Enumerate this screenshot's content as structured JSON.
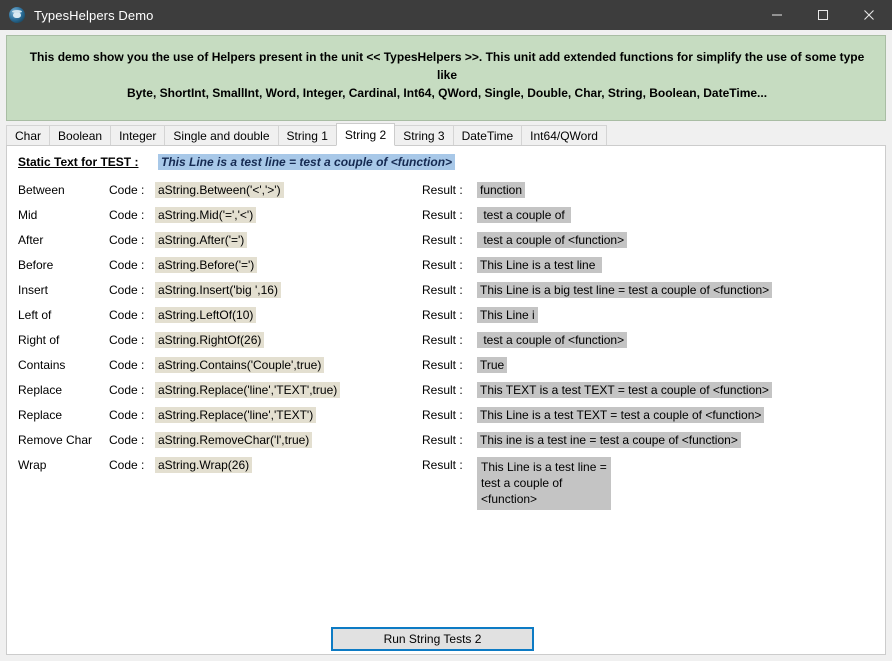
{
  "window": {
    "title": "TypesHelpers Demo",
    "icon": "app-paw-icon",
    "controls": {
      "minimize": "minimize-icon",
      "maximize": "maximize-icon",
      "close": "close-icon"
    },
    "colors": {
      "titlebar": "#3d3d3d",
      "banner_bg": "#c6dcc1",
      "code_bg": "#e3dfd0",
      "result_bg": "#c4c4c4",
      "static_highlight_bg": "#a8c8e8",
      "static_highlight_fg": "#152a52",
      "button_focus_border": "#0d7bc4"
    }
  },
  "banner": {
    "line1": "This demo show you the use of Helpers present in the unit << TypesHelpers >>. This unit add extended functions for simplify the use of some type like",
    "line2": "Byte, ShortInt, SmallInt, Word, Integer, Cardinal, Int64, QWord, Single, Double, Char, String, Boolean, DateTime..."
  },
  "tabs": [
    {
      "label": "Char",
      "active": false
    },
    {
      "label": "Boolean",
      "active": false
    },
    {
      "label": "Integer",
      "active": false
    },
    {
      "label": "Single and double",
      "active": false
    },
    {
      "label": "String 1",
      "active": false
    },
    {
      "label": "String 2",
      "active": true
    },
    {
      "label": "String 3",
      "active": false
    },
    {
      "label": "DateTime",
      "active": false
    },
    {
      "label": "Int64/QWord",
      "active": false
    }
  ],
  "page": {
    "static_label": "Static Text for TEST :",
    "static_value": "This Line is a test line = test a couple of <function>",
    "code_label": "Code :",
    "result_label": "Result :",
    "rows": [
      {
        "name": "Between",
        "code": "aString.Between('<','>')",
        "result": "function"
      },
      {
        "name": "Mid",
        "code": "aString.Mid('=','<')",
        "result": " test a couple of "
      },
      {
        "name": "After",
        "code": "aString.After('=')",
        "result": " test a couple of <function>"
      },
      {
        "name": "Before",
        "code": "aString.Before('=')",
        "result": "This Line is a test line "
      },
      {
        "name": "Insert",
        "code": "aString.Insert('big ',16)",
        "result": "This Line is a big test line = test a couple of <function>"
      },
      {
        "name": "Left of",
        "code": "aString.LeftOf(10)",
        "result": "This Line i"
      },
      {
        "name": "Right of",
        "code": "aString.RightOf(26)",
        "result": " test a couple of <function>"
      },
      {
        "name": "Contains",
        "code": "aString.Contains('Couple',true)",
        "result": "True"
      },
      {
        "name": "Replace",
        "code": "aString.Replace('line','TEXT',true)",
        "result": "This TEXT is a test TEXT = test a couple of <function>"
      },
      {
        "name": "Replace",
        "code": "aString.Replace('line','TEXT')",
        "result": "This Line is a test TEXT = test a couple of <function>"
      },
      {
        "name": "Remove Char",
        "code": "aString.RemoveChar('l',true)",
        "result": "This ine is a test ine = test a coupe of <function>"
      },
      {
        "name": "Wrap",
        "code": "aString.Wrap(26)",
        "result": "This Line is a test line =\ntest a couple of\n<function>",
        "multiline": true
      }
    ],
    "run_button": "Run String Tests 2"
  }
}
